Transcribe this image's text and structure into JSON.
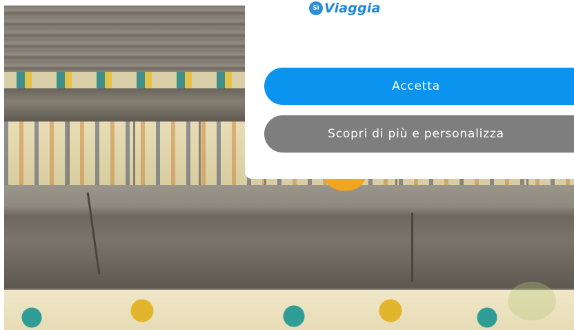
{
  "brand": {
    "name": "Viaggia",
    "icon_text": "Sì"
  },
  "buttons": {
    "accept_label": "Accetta",
    "more_label": "Scopri di più e personalizza"
  },
  "colors": {
    "accept": "#0a94f0",
    "more": "#7e7e7e",
    "brand": "#1f86d6"
  }
}
